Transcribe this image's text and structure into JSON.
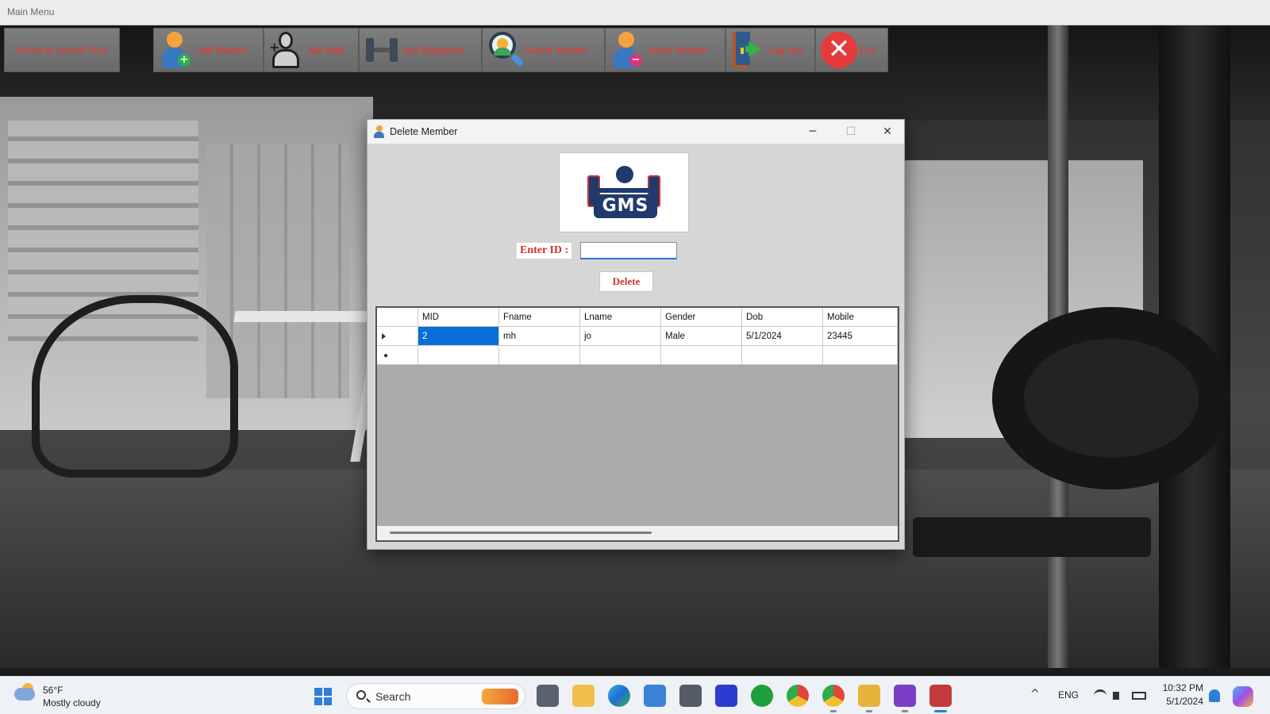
{
  "main_window": {
    "title": "Main Menu"
  },
  "toolbar": {
    "buttons": [
      {
        "label": "Switch to Vertical View",
        "icon": "none"
      },
      {
        "label": "Add Member",
        "icon": "add-member-icon"
      },
      {
        "label": "Add Staff",
        "icon": "add-staff-icon"
      },
      {
        "label": "Add Equipment",
        "icon": "dumbbell-icon"
      },
      {
        "label": "Search Member",
        "icon": "search-member-icon"
      },
      {
        "label": "Delete Member",
        "icon": "delete-member-icon"
      },
      {
        "label": "Log Out",
        "icon": "logout-door-icon"
      },
      {
        "label": "Exit",
        "icon": "exit-x-icon"
      }
    ]
  },
  "dialog": {
    "title": "Delete Member",
    "logo_text": "GMS",
    "id_label": "Enter ID :",
    "id_value": "",
    "delete_label": "Delete",
    "grid": {
      "columns": [
        "MID",
        "Fname",
        "Lname",
        "Gender",
        "Dob",
        "Mobile"
      ],
      "rows": [
        [
          "2",
          "mh",
          "jo",
          "Male",
          "5/1/2024",
          "23445"
        ]
      ],
      "selected_cell": "MID"
    }
  },
  "taskbar": {
    "weather": {
      "temp": "56°F",
      "desc": "Mostly cloudy"
    },
    "search_label": "Search",
    "language": "ENG",
    "time": "10:32 PM",
    "date": "5/1/2024"
  },
  "colors": {
    "accent_red": "#e53935",
    "selection_blue": "#0a6fd8",
    "toolbar_gray": "#737373"
  }
}
